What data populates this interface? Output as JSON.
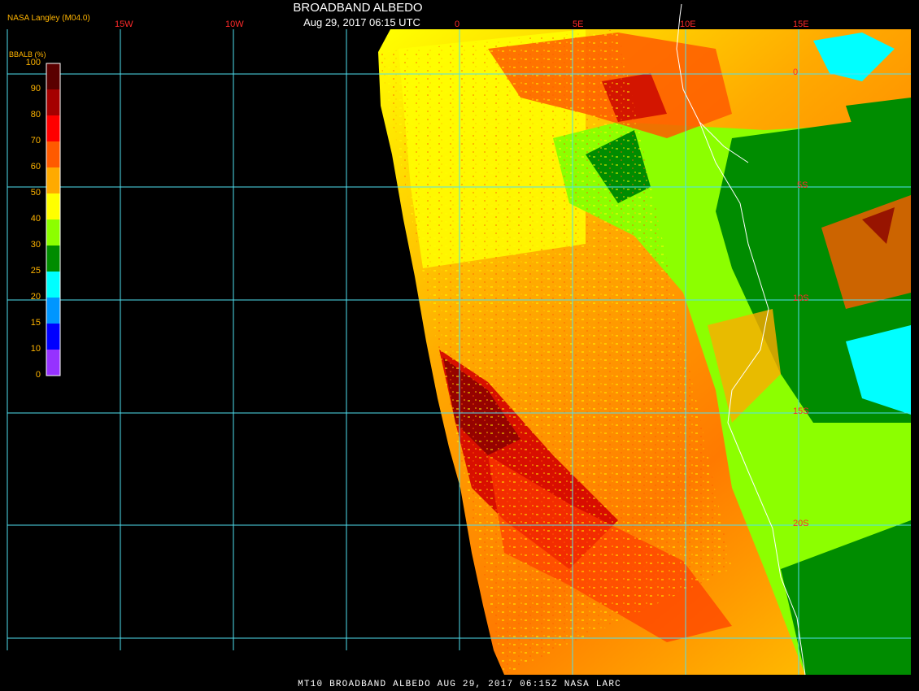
{
  "header": {
    "producer": "NASA Langley (M04.0)",
    "title": "BROADBAND ALBEDO",
    "datetime": "Aug 29, 2017 06:15 UTC"
  },
  "colorbar": {
    "title": "BBALB (%)",
    "labels": [
      "100",
      "90",
      "80",
      "70",
      "60",
      "50",
      "40",
      "30",
      "25",
      "20",
      "15",
      "10",
      "0"
    ],
    "colors": [
      "#5a0000",
      "#a50000",
      "#ff0000",
      "#ff5a00",
      "#ffaa00",
      "#ffff00",
      "#8cff00",
      "#008c00",
      "#00ffff",
      "#0096ff",
      "#0000ff",
      "#9632ff"
    ]
  },
  "grid": {
    "color": "#4fe0f0",
    "lon_labels": [
      "15W",
      "10W",
      "0",
      "5E",
      "10E",
      "15E"
    ],
    "lat_labels": [
      "0",
      "5S",
      "10S",
      "15S",
      "20S"
    ]
  },
  "footer": "MT10  BROADBAND ALBEDO   AUG 29, 2017 06:15Z   NASA LARC"
}
